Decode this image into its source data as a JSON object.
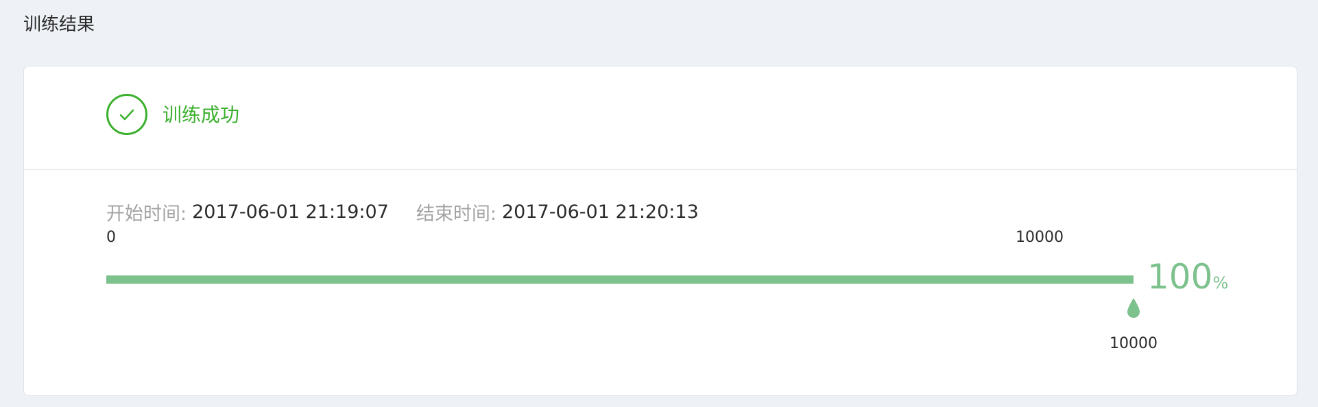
{
  "page": {
    "title": "训练结果"
  },
  "status": {
    "text": "训练成功",
    "icon": "check-circle-icon",
    "color": "#3bb02d"
  },
  "times": {
    "start_label": "开始时间:",
    "start_value": "2017-06-01 21:19:07",
    "end_label": "结束时间:",
    "end_value": "2017-06-01 21:20:13"
  },
  "progress": {
    "min_label": "0",
    "max_label": "10000",
    "current_label": "10000",
    "min": 0,
    "max": 10000,
    "current": 10000,
    "percent_value": "100",
    "percent_unit": "%",
    "marker_icon": "droplet-marker-icon",
    "color": "#7dc18d"
  }
}
